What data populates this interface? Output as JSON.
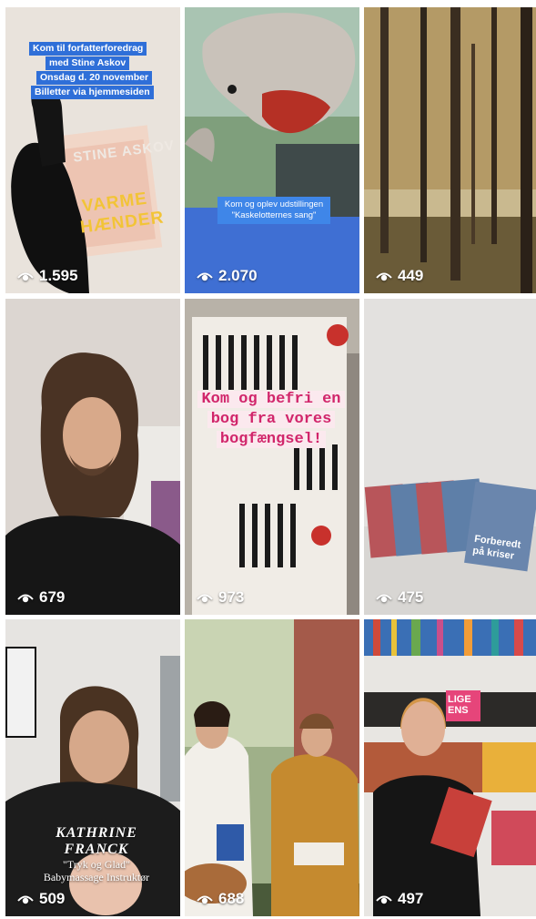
{
  "tiles": [
    {
      "views": "1.595",
      "caption_lines": [
        "Kom til forfatterforedrag",
        "med Stine Askov",
        "Onsdag d. 20 november",
        "Billetter via hjemmesiden"
      ],
      "book_author": "STINE ASKOV",
      "book_title_1": "VARME",
      "book_title_2": "HÆNDER"
    },
    {
      "views": "2.070",
      "caption_lines": [
        "Kom og oplev udstillingen",
        "\"Kaskelotternes sang\""
      ]
    },
    {
      "views": "449"
    },
    {
      "views": "679"
    },
    {
      "views": "973",
      "overlay_lines": [
        "Kom og befri en",
        "bog fra vores",
        "bogfængsel!"
      ]
    },
    {
      "views": "475",
      "leaflet_text": "Forberedt på kriser"
    },
    {
      "views": "509",
      "name": "KATHRINE FRANCK",
      "subtitle": "\"Tryk og Glad\"",
      "role": "Babymassage Instruktør"
    },
    {
      "views": "688"
    },
    {
      "views": "497",
      "shelf_sign": "LIGE ENS"
    }
  ],
  "icons": {
    "views": "eye-icon"
  }
}
